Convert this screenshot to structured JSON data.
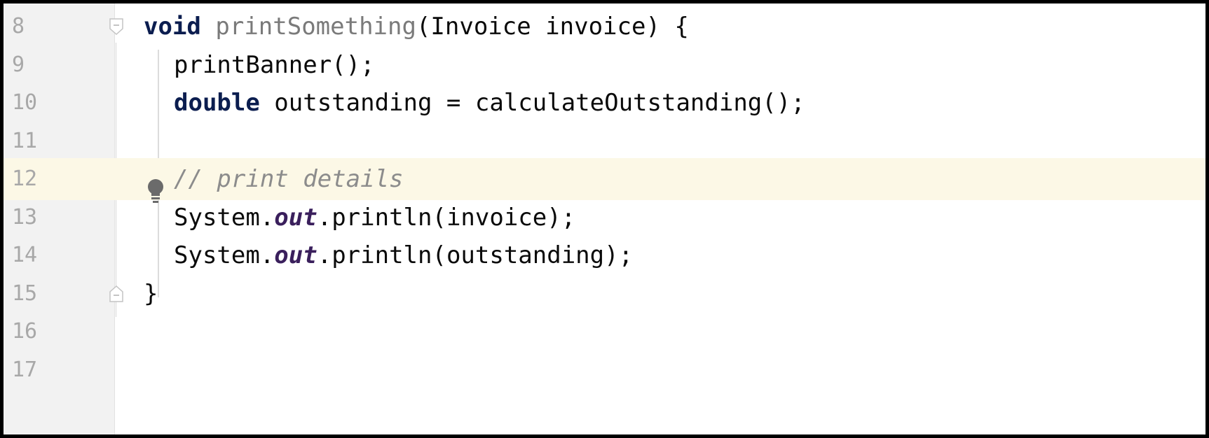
{
  "editor": {
    "lines": [
      {
        "number": "8",
        "tokens": [
          {
            "text": "void",
            "style": "kw"
          },
          {
            "text": " ",
            "style": ""
          },
          {
            "text": "printSomething",
            "style": "method"
          },
          {
            "text": "(Invoice invoice) {",
            "style": ""
          }
        ]
      },
      {
        "number": "9",
        "tokens": [
          {
            "text": "printBanner();",
            "style": ""
          }
        ]
      },
      {
        "number": "10",
        "tokens": [
          {
            "text": "double",
            "style": "kw"
          },
          {
            "text": " outstanding = calculateOutstanding();",
            "style": ""
          }
        ]
      },
      {
        "number": "11",
        "tokens": []
      },
      {
        "number": "12",
        "tokens": [
          {
            "text": "// print details",
            "style": "comment"
          }
        ]
      },
      {
        "number": "13",
        "tokens": [
          {
            "text": "System.",
            "style": ""
          },
          {
            "text": "out",
            "style": "field"
          },
          {
            "text": ".println(invoice);",
            "style": ""
          }
        ]
      },
      {
        "number": "14",
        "tokens": [
          {
            "text": "System.",
            "style": ""
          },
          {
            "text": "out",
            "style": "field"
          },
          {
            "text": ".println(outstanding);",
            "style": ""
          }
        ]
      },
      {
        "number": "15",
        "tokens": [
          {
            "text": "}",
            "style": ""
          }
        ]
      },
      {
        "number": "16",
        "tokens": []
      },
      {
        "number": "17",
        "tokens": []
      }
    ]
  },
  "icons": {
    "fold_open": "fold-open-icon",
    "fold_close": "fold-close-icon",
    "intention": "lightbulb-icon"
  },
  "colors": {
    "highlight_line": "#fcf8e6",
    "gutter_bg": "#f2f2f2",
    "keyword": "#0b1d4f",
    "comment": "#8c8c8c",
    "line_number": "#a8a8a8"
  }
}
